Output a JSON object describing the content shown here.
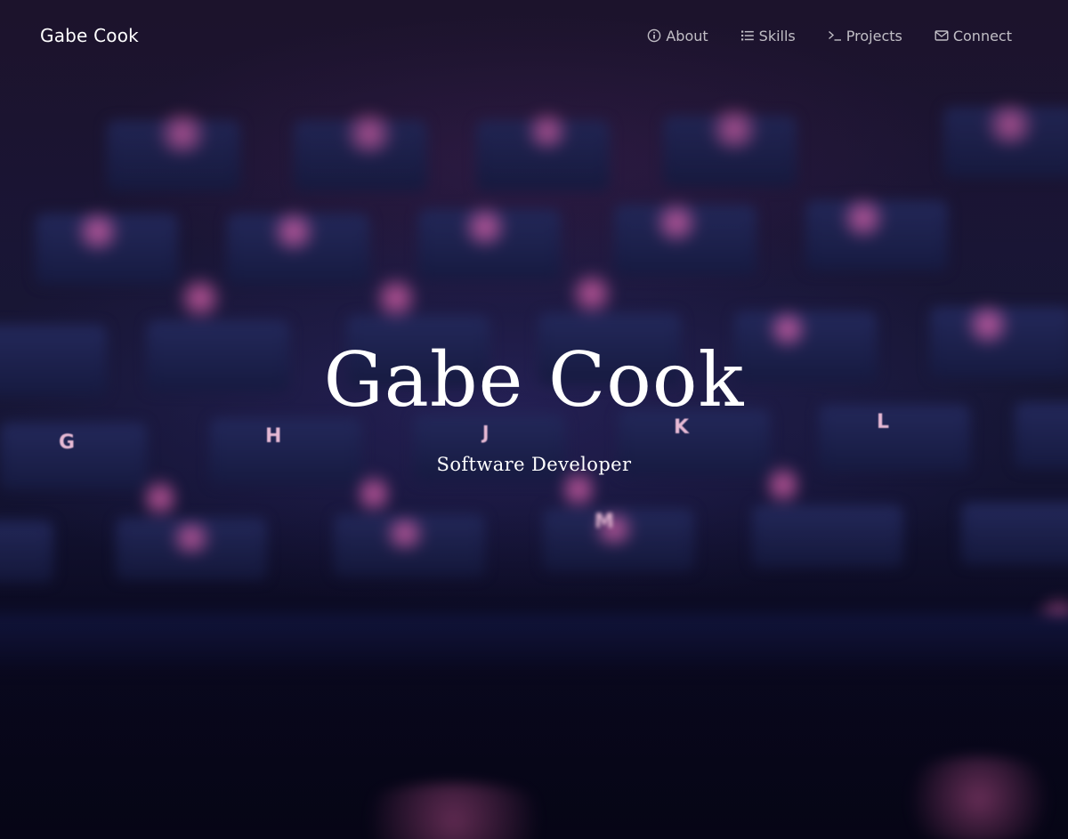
{
  "navbar": {
    "brand": "Gabe Cook",
    "links": [
      {
        "label": "About",
        "icon": "info-circle-icon"
      },
      {
        "label": "Skills",
        "icon": "list-icon"
      },
      {
        "label": "Projects",
        "icon": "terminal-icon"
      },
      {
        "label": "Connect",
        "icon": "envelope-icon"
      }
    ]
  },
  "masthead": {
    "title": "Gabe Cook",
    "subtitle": "Software Developer"
  },
  "background": {
    "keycaps": [
      "G",
      "H",
      "J",
      "K",
      "L",
      "M"
    ]
  },
  "colors": {
    "background_dark": "#0d0a1e",
    "keycap": "#1c2150",
    "key_glow": "#ff6ebe",
    "text": "#ffffff"
  }
}
